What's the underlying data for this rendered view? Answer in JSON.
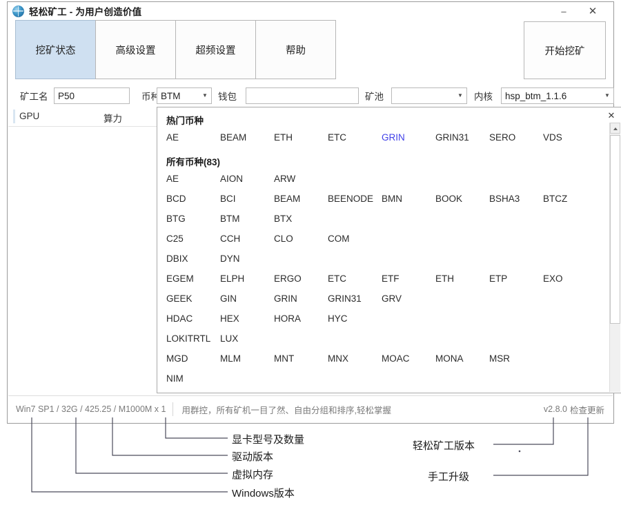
{
  "window": {
    "title": "轻松矿工 - 为用户创造价值",
    "icon": "globe-icon",
    "minimize_label": "–",
    "close_label": "✕"
  },
  "tabs": [
    {
      "label": "挖矿状态",
      "active": true
    },
    {
      "label": "高级设置",
      "active": false
    },
    {
      "label": "超频设置",
      "active": false
    },
    {
      "label": "帮助",
      "active": false
    }
  ],
  "start_button": {
    "label": "开始挖矿"
  },
  "form": {
    "miner_name": {
      "label": "矿工名",
      "value": "P50",
      "placeholder": ""
    },
    "coin": {
      "label": "币种",
      "value": "BTM"
    },
    "wallet": {
      "label": "钱包",
      "value": "",
      "placeholder": ""
    },
    "pool": {
      "label": "矿池",
      "value": ""
    },
    "kernel": {
      "label": "内核",
      "value": "hsp_btm_1.1.6"
    }
  },
  "list": {
    "columns": [
      "GPU",
      "算力"
    ],
    "rows": []
  },
  "coin_panel": {
    "close_label": "✕",
    "hot_title": "热门币种",
    "all_title": "所有币种(83)",
    "highlight_color": "#4040e8",
    "hot_coins": [
      "AE",
      "BEAM",
      "ETH",
      "ETC",
      "GRIN",
      "GRIN31",
      "SERO",
      "VDS"
    ],
    "highlighted_coin": "GRIN",
    "all_coin_rows": [
      [
        "AE",
        "AION",
        "ARW"
      ],
      [
        "BCD",
        "BCI",
        "BEAM",
        "BEENODE",
        "BMN",
        "BOOK",
        "BSHA3",
        "BTCZ"
      ],
      [
        "BTG",
        "BTM",
        "BTX"
      ],
      [
        "C25",
        "CCH",
        "CLO",
        "COM"
      ],
      [
        "DBIX",
        "DYN"
      ],
      [
        "EGEM",
        "ELPH",
        "ERGO",
        "ETC",
        "ETF",
        "ETH",
        "ETP",
        "EXO"
      ],
      [
        "GEEK",
        "GIN",
        "GRIN",
        "GRIN31",
        "GRV"
      ],
      [
        "HDAC",
        "HEX",
        "HORA",
        "HYC"
      ],
      [
        "LOKITRTL",
        "LUX"
      ],
      [
        "MGD",
        "MLM",
        "MNT",
        "MNX",
        "MOAC",
        "MONA",
        "MSR"
      ],
      [
        "NIM"
      ]
    ]
  },
  "status_bar": {
    "sysinfo": "Win7 SP1 / 32G / 425.25 / M1000M x 1",
    "message": "用群控，所有矿机一目了然、自由分组和排序,轻松掌握",
    "version": "v2.8.0",
    "update_link": "检查更新"
  },
  "annotations": [
    {
      "label": "显卡型号及数量"
    },
    {
      "label": "驱动版本"
    },
    {
      "label": "虚拟内存"
    },
    {
      "label": "Windows版本"
    },
    {
      "label": "轻松矿工版本"
    },
    {
      "label": "手工升级"
    }
  ]
}
